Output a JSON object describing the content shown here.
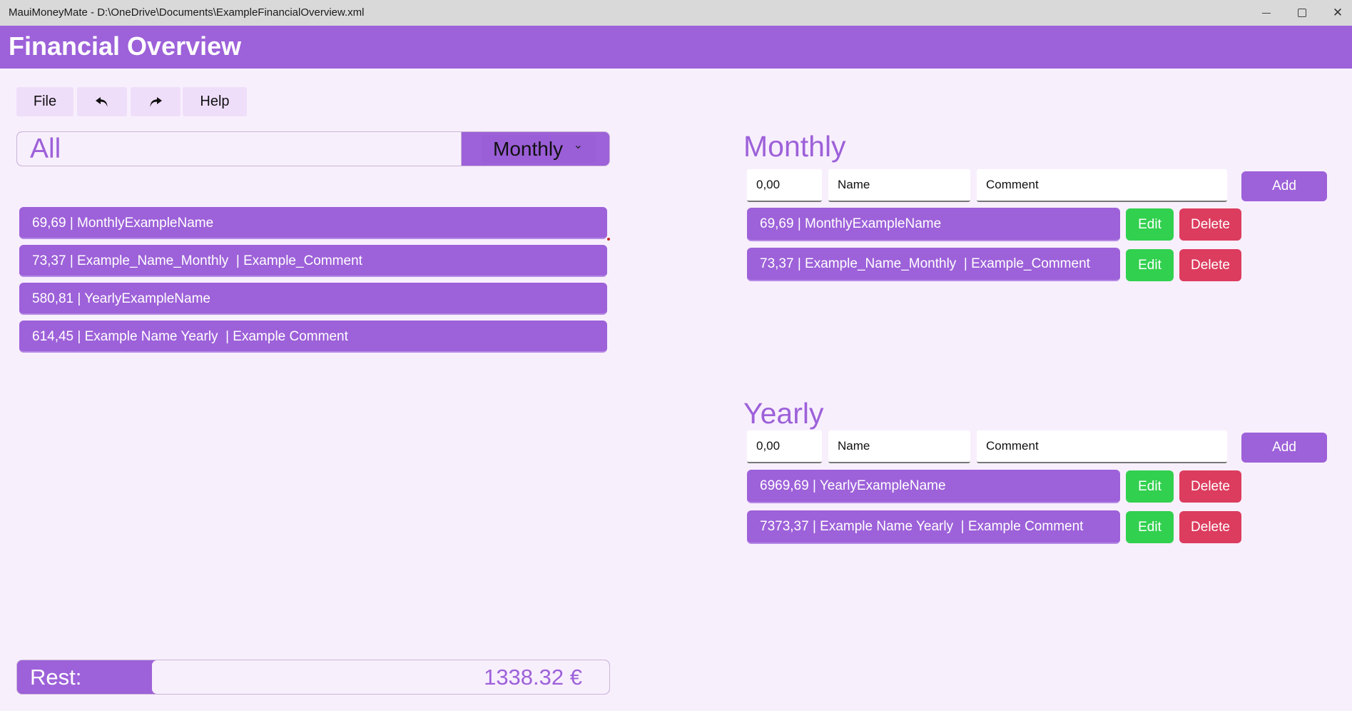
{
  "window": {
    "title": "MauiMoneyMate - D:\\OneDrive\\Documents\\ExampleFinancialOverview.xml",
    "close_glyph": "✕"
  },
  "header": {
    "title": "Financial Overview"
  },
  "menu": {
    "file_label": "File",
    "undo_icon": "undo-icon",
    "redo_icon": "redo-icon",
    "help_label": "Help"
  },
  "filter": {
    "search_text": "All",
    "period_selected": "Monthly",
    "chevron": "⌄"
  },
  "overview_list": [
    {
      "text": "69,69 | MonthlyExampleName"
    },
    {
      "text": "73,37 | Example_Name_Monthly  | Example_Comment"
    },
    {
      "text": "580,81 | YearlyExampleName"
    },
    {
      "text": "614,45 | Example Name Yearly  | Example Comment"
    }
  ],
  "rest": {
    "label": "Rest:",
    "value": "1338.32 €"
  },
  "monthly": {
    "title": "Monthly",
    "amount_value": "0,00",
    "name_value": "Name",
    "comment_value": "Comment",
    "add_label": "Add",
    "items": [
      {
        "text": "69,69 | MonthlyExampleName",
        "edit": "Edit",
        "delete": "Delete"
      },
      {
        "text": "73,37 | Example_Name_Monthly  | Example_Comment",
        "edit": "Edit",
        "delete": "Delete"
      }
    ]
  },
  "yearly": {
    "title": "Yearly",
    "amount_value": "0,00",
    "name_value": "Name",
    "comment_value": "Comment",
    "add_label": "Add",
    "items": [
      {
        "text": "6969,69 | YearlyExampleName",
        "edit": "Edit",
        "delete": "Delete"
      },
      {
        "text": "7373,37 | Example Name Yearly  | Example Comment",
        "edit": "Edit",
        "delete": "Delete"
      }
    ]
  },
  "colors": {
    "accent": "#9d61d9",
    "background": "#f8effd",
    "edit": "#32d04f",
    "delete": "#dc3c5e"
  }
}
